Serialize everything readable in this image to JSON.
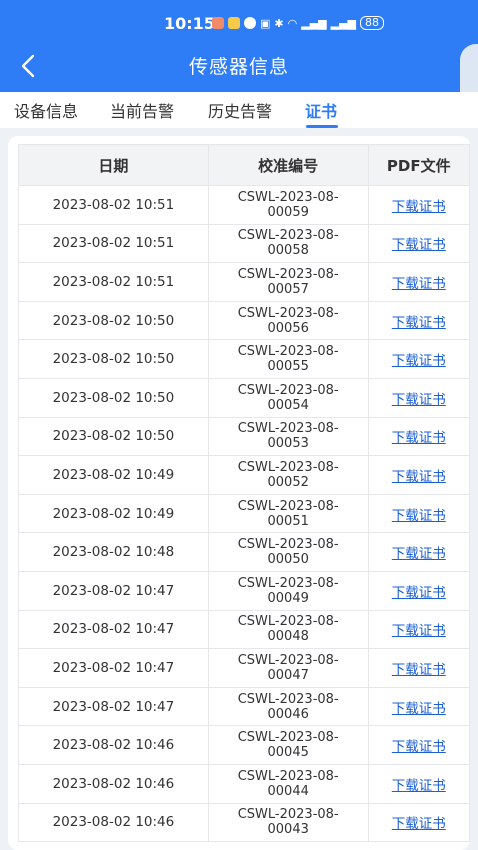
{
  "status_bar": {
    "time": "10:15",
    "battery": "88"
  },
  "header": {
    "title": "传感器信息"
  },
  "tabs": [
    {
      "label": "设备信息"
    },
    {
      "label": "当前告警"
    },
    {
      "label": "历史告警"
    },
    {
      "label": "证书"
    }
  ],
  "table": {
    "headers": [
      "日期",
      "校准编号",
      "PDF文件"
    ],
    "rows": [
      {
        "date": "2023-08-02 10:51",
        "code_line1": "CSWL-2023-08-",
        "code_line2": "00059",
        "pdf": "下载证书"
      },
      {
        "date": "2023-08-02 10:51",
        "code_line1": "CSWL-2023-08-",
        "code_line2": "00058",
        "pdf": "下载证书"
      },
      {
        "date": "2023-08-02 10:51",
        "code_line1": "CSWL-2023-08-",
        "code_line2": "00057",
        "pdf": "下载证书"
      },
      {
        "date": "2023-08-02 10:50",
        "code_line1": "CSWL-2023-08-",
        "code_line2": "00056",
        "pdf": "下载证书"
      },
      {
        "date": "2023-08-02 10:50",
        "code_line1": "CSWL-2023-08-",
        "code_line2": "00055",
        "pdf": "下载证书"
      },
      {
        "date": "2023-08-02 10:50",
        "code_line1": "CSWL-2023-08-",
        "code_line2": "00054",
        "pdf": "下载证书"
      },
      {
        "date": "2023-08-02 10:50",
        "code_line1": "CSWL-2023-08-",
        "code_line2": "00053",
        "pdf": "下载证书"
      },
      {
        "date": "2023-08-02 10:49",
        "code_line1": "CSWL-2023-08-",
        "code_line2": "00052",
        "pdf": "下载证书"
      },
      {
        "date": "2023-08-02 10:49",
        "code_line1": "CSWL-2023-08-",
        "code_line2": "00051",
        "pdf": "下载证书"
      },
      {
        "date": "2023-08-02 10:48",
        "code_line1": "CSWL-2023-08-",
        "code_line2": "00050",
        "pdf": "下载证书"
      },
      {
        "date": "2023-08-02 10:47",
        "code_line1": "CSWL-2023-08-",
        "code_line2": "00049",
        "pdf": "下载证书"
      },
      {
        "date": "2023-08-02 10:47",
        "code_line1": "CSWL-2023-08-",
        "code_line2": "00048",
        "pdf": "下载证书"
      },
      {
        "date": "2023-08-02 10:47",
        "code_line1": "CSWL-2023-08-",
        "code_line2": "00047",
        "pdf": "下载证书"
      },
      {
        "date": "2023-08-02 10:47",
        "code_line1": "CSWL-2023-08-",
        "code_line2": "00046",
        "pdf": "下载证书"
      },
      {
        "date": "2023-08-02 10:46",
        "code_line1": "CSWL-2023-08-",
        "code_line2": "00045",
        "pdf": "下载证书"
      },
      {
        "date": "2023-08-02 10:46",
        "code_line1": "CSWL-2023-08-",
        "code_line2": "00044",
        "pdf": "下载证书"
      },
      {
        "date": "2023-08-02 10:46",
        "code_line1": "CSWL-2023-08-",
        "code_line2": "00043",
        "pdf": "下载证书"
      }
    ]
  },
  "colors": {
    "primary": "#2f7df6",
    "link": "#1b5fd6",
    "page_bg": "#eef2f7"
  }
}
